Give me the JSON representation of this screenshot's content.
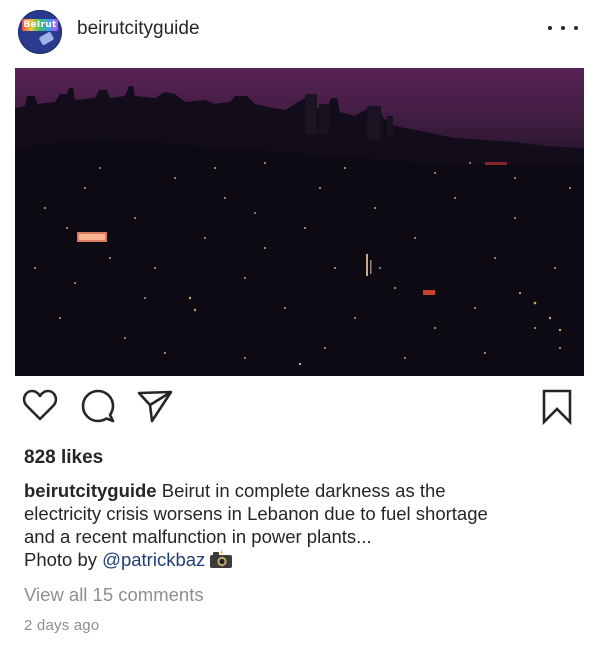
{
  "post": {
    "username": "beirutcityguide",
    "avatar_text": "BeIrut",
    "likes": "828 likes",
    "caption_user": "beirutcityguide",
    "caption_line1": "Beirut in complete darkness as the",
    "caption_line2": "electricity crisis worsens in Lebanon due to fuel shortage",
    "caption_line3": "and a recent malfunction in power plants...",
    "photo_by": "Photo by",
    "mention": "@patrickbaz",
    "view_comments": "View all 15 comments",
    "timestamp": "2 days ago"
  },
  "icons": {
    "more": "more-options-icon",
    "like": "heart-icon",
    "comment": "comment-bubble-icon",
    "share": "paper-plane-icon",
    "save": "bookmark-icon",
    "camera": "camera-flash-emoji"
  },
  "colors": {
    "text": "#262626",
    "muted": "#8e8e8e",
    "mention": "#1f3f7a"
  }
}
